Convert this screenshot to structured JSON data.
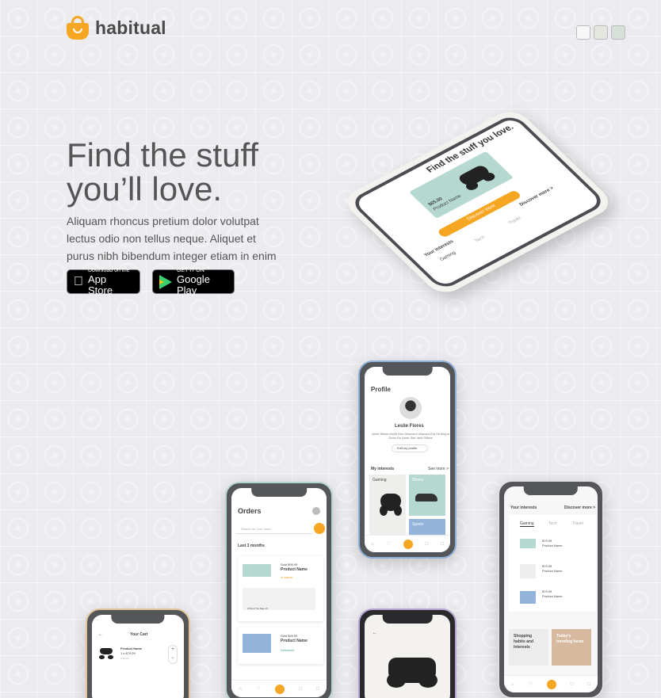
{
  "brand": {
    "name": "habitual",
    "accent": "#f5a623"
  },
  "hero": {
    "title": "Find the stuff you’ll love.",
    "description": "Aliquam rhoncus pretium dolor volutpat lectus odio non tellus neque. Aliquet et purus nibh bibendum integer etiam in enim nisi."
  },
  "stores": {
    "apple_small": "Download on the",
    "apple_big": "App Store",
    "google_small": "GET IT ON",
    "google_big": "Google Play"
  },
  "swatches": [
    "#f7f7f7",
    "#e4e6e0",
    "#d6dfd8"
  ],
  "tilt_phone": {
    "title": "Find the stuff you love.",
    "price": "$65.00",
    "product": "Product Name",
    "button": "Discover more",
    "section": "Your interests",
    "see_more": "Discover more >",
    "tabs": [
      "Gaming",
      "Tech",
      "Travel"
    ]
  },
  "profile_phone": {
    "title": "Profile",
    "name": "Leslie Flores",
    "bio": "Amet Minim Mollit Non Deserunt Ullamco Est Sit Aliqua Dolor Do Amet Sint Velit Officia",
    "edit_button": "Edit my profile",
    "interests_label": "My interests",
    "see_more": "See more >",
    "cards": [
      "Gaming",
      "Shoes",
      "Sports"
    ]
  },
  "orders_phone": {
    "title": "Orders",
    "search_placeholder": "Search for your order",
    "period": "Last 3 months",
    "orders": [
      {
        "price": "Sold $99.99",
        "name": "Product Name",
        "status": "In transit",
        "date": "Arrives Tue May 16"
      },
      {
        "price": "Sold $99.99",
        "name": "Product Name",
        "status": "Delivered"
      }
    ]
  },
  "cart_phone": {
    "title": "Your Cart",
    "product": "Product Name",
    "price": "1 x $79.99",
    "color": "COLOR"
  },
  "interests_phone": {
    "title": "Your interests",
    "discover": "Discover more >",
    "tabs": [
      "Gaming",
      "Tech",
      "Travel"
    ],
    "products": [
      {
        "price": "$79.99",
        "name": "Product Name"
      },
      {
        "price": "$79.99",
        "name": "Product Name"
      },
      {
        "price": "$79.99",
        "name": "Product Name"
      }
    ],
    "card_a": "Shopping habits and interests",
    "card_b": "Today's trending items"
  }
}
